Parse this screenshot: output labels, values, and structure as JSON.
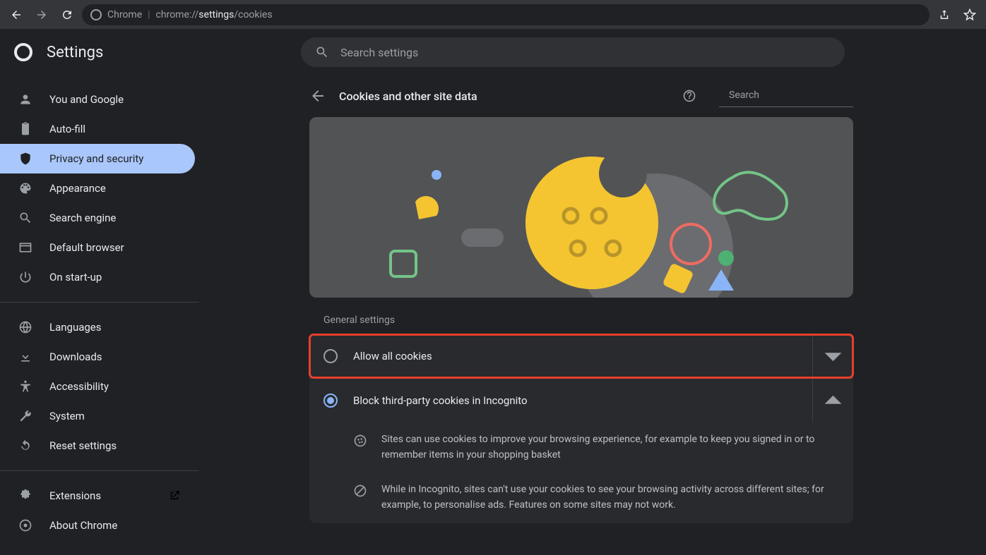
{
  "browser": {
    "url_prefix": "chrome://",
    "url_strong": "settings",
    "url_suffix": "/cookies",
    "site_label": "Chrome"
  },
  "header": {
    "title": "Settings",
    "search_placeholder": "Search settings"
  },
  "sidebar": {
    "items": [
      {
        "label": "You and Google"
      },
      {
        "label": "Auto-fill"
      },
      {
        "label": "Privacy and security"
      },
      {
        "label": "Appearance"
      },
      {
        "label": "Search engine"
      },
      {
        "label": "Default browser"
      },
      {
        "label": "On start-up"
      }
    ],
    "items2": [
      {
        "label": "Languages"
      },
      {
        "label": "Downloads"
      },
      {
        "label": "Accessibility"
      },
      {
        "label": "System"
      },
      {
        "label": "Reset settings"
      }
    ],
    "items3": [
      {
        "label": "Extensions"
      },
      {
        "label": "About Chrome"
      }
    ]
  },
  "subpage": {
    "title": "Cookies and other site data",
    "search_placeholder": "Search"
  },
  "section": {
    "title": "General settings",
    "options": [
      {
        "label": "Allow all cookies"
      },
      {
        "label": "Block third-party cookies in Incognito"
      }
    ],
    "details": [
      "Sites can use cookies to improve your browsing experience, for example to keep you signed in or to remember items in your shopping basket",
      "While in Incognito, sites can't use your cookies to see your browsing activity across different sites; for example, to personalise ads. Features on some sites may not work."
    ]
  }
}
